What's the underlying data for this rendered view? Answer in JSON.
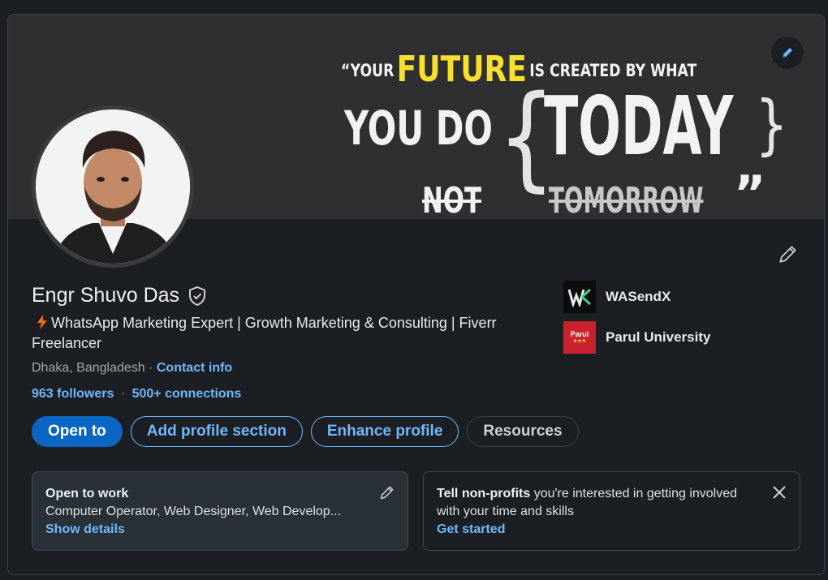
{
  "profile": {
    "name": "Engr Shuvo Das",
    "headline_icon": "lightning-icon",
    "headline": "WhatsApp Marketing Expert | Growth Marketing & Consulting | Fiverr Freelancer",
    "location": "Dhaka, Bangladesh",
    "location_sep": " · ",
    "contact_info": "Contact info",
    "followers": "963 followers",
    "stats_sep": "·",
    "connections": "500+ connections"
  },
  "cover": {
    "quote_open": "“YOUR",
    "quote_future": "FUTURE",
    "quote_rest": "IS CREATED BY WHAT",
    "quote_youdo": "YOU DO",
    "quote_brace_open": "{",
    "quote_today": "TODAY",
    "quote_brace_close": "}",
    "quote_not": "NOT",
    "quote_tomorrow": "TOMORROW",
    "quote_close": "”"
  },
  "organizations": [
    {
      "name": "WASendX",
      "logo": "wasendx-logo",
      "logo_text": "W"
    },
    {
      "name": "Parul University",
      "logo": "parul-university-logo",
      "logo_text": "Parul"
    }
  ],
  "actions": {
    "open_to": "Open to",
    "add_section": "Add profile section",
    "enhance": "Enhance profile",
    "resources": "Resources"
  },
  "open_to_work": {
    "title": "Open to work",
    "roles": "Computer Operator, Web Designer, Web Develop...",
    "link": "Show details"
  },
  "nonprofits": {
    "title_bold": "Tell non-profits",
    "title_rest": " you're interested in getting involved with your time and skills",
    "link": "Get started"
  },
  "colors": {
    "accent": "#71b7fb",
    "primary": "#0a66c2",
    "background": "#1b1f23",
    "future_yellow": "#f6df2d",
    "parul_red": "#c8232c"
  }
}
